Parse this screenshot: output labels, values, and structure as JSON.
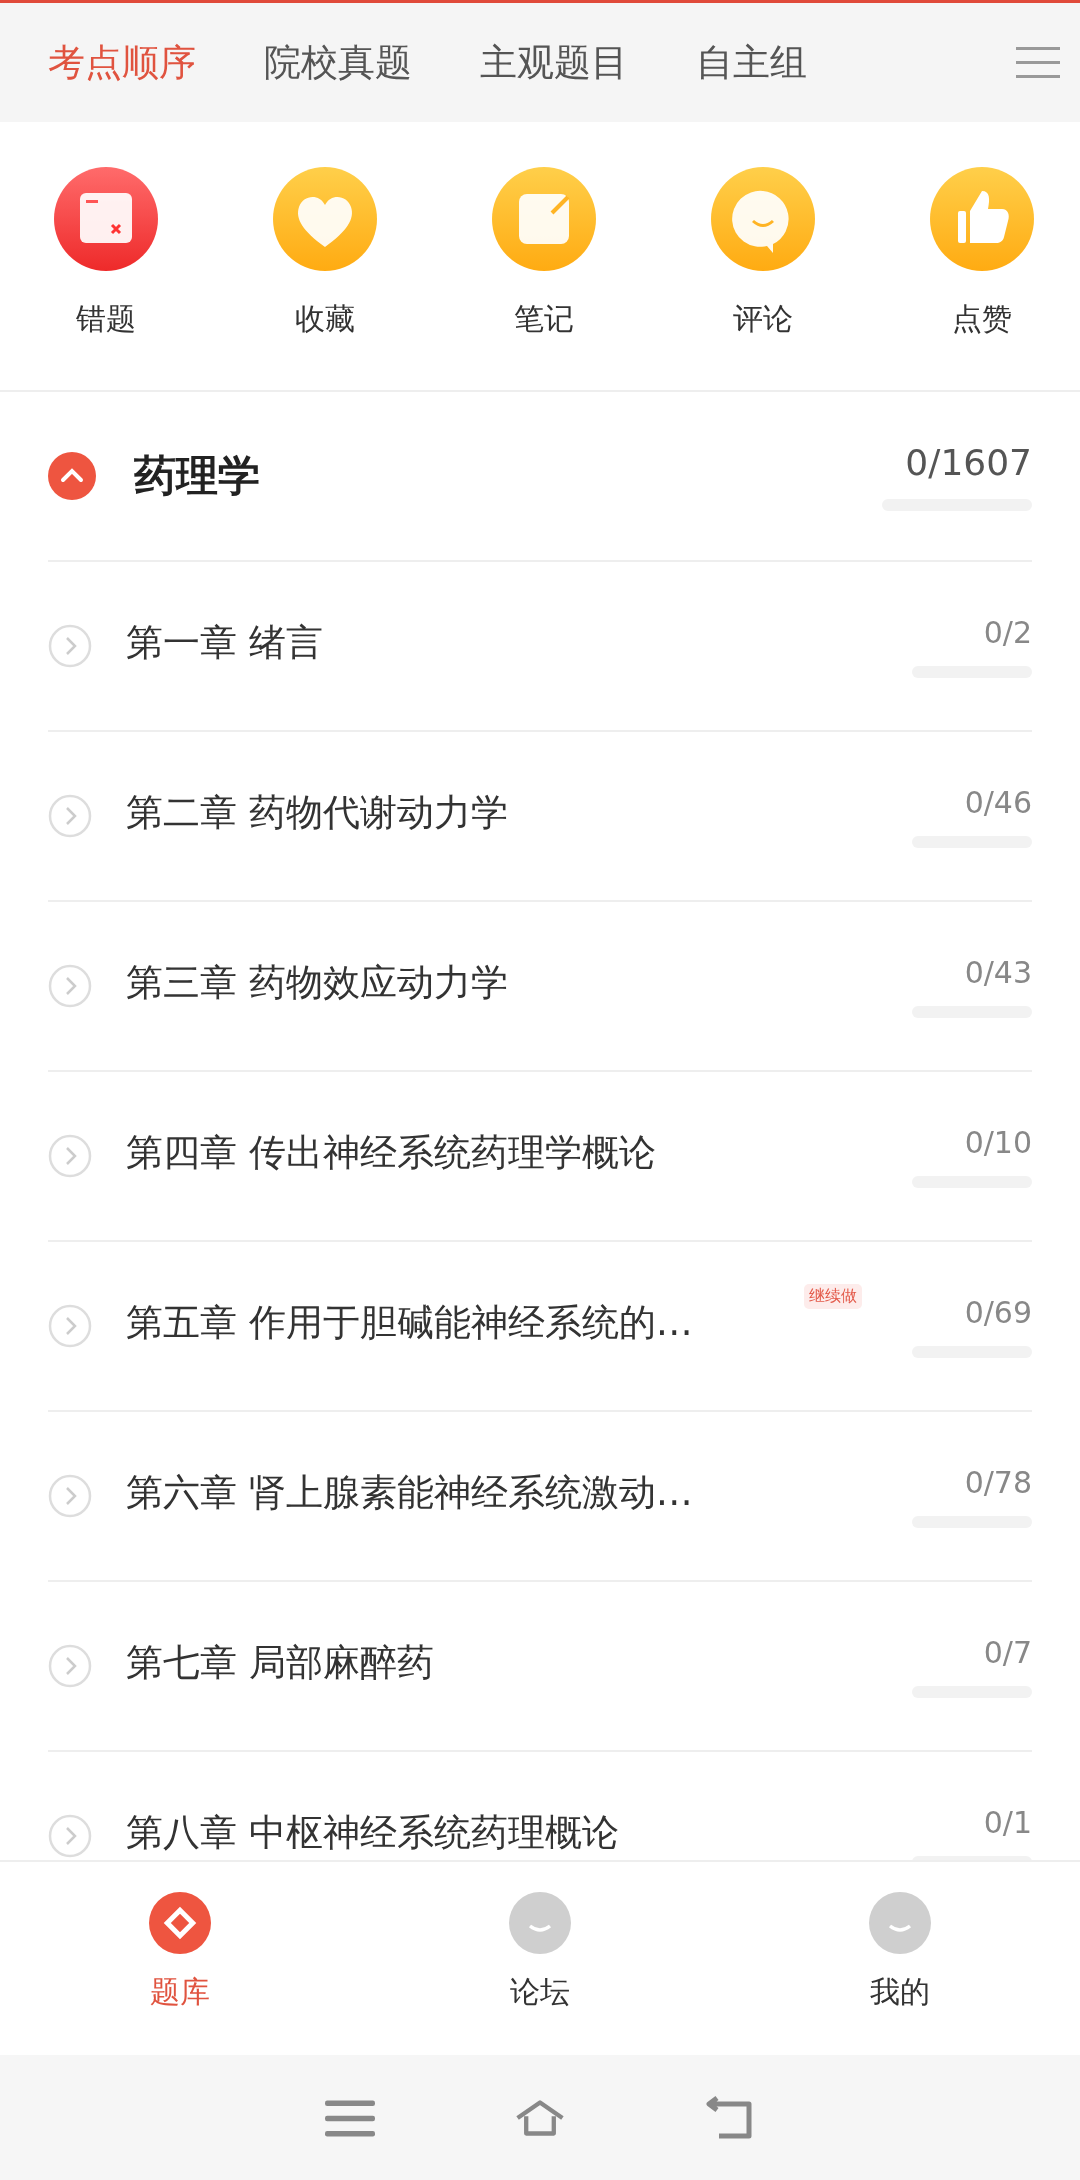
{
  "tabs": [
    {
      "label": "考点顺序",
      "selected": true
    },
    {
      "label": "院校真题",
      "selected": false
    },
    {
      "label": "主观题目",
      "selected": false
    },
    {
      "label": "自主组",
      "selected": false
    }
  ],
  "shortcuts": [
    {
      "label": "错题",
      "kind": "wrong"
    },
    {
      "label": "收藏",
      "kind": "favorite"
    },
    {
      "label": "笔记",
      "kind": "note"
    },
    {
      "label": "评论",
      "kind": "comment"
    },
    {
      "label": "点赞",
      "kind": "like"
    }
  ],
  "subject": {
    "title": "药理学",
    "count": "0/1607",
    "level": 0,
    "expanded": true
  },
  "chapters": [
    {
      "title": "第一章 绪言",
      "count": "0/2",
      "level": 0
    },
    {
      "title": "第二章 药物代谢动力学",
      "count": "0/46",
      "level": 0
    },
    {
      "title": "第三章 药物效应动力学",
      "count": "0/43",
      "level": 0
    },
    {
      "title": "第四章 传出神经系统药理学概论",
      "count": "0/10",
      "level": 0
    },
    {
      "title": "第五章 作用于胆碱能神经系统的…",
      "count": "0/69",
      "level": 0,
      "badge": "继续做"
    },
    {
      "title": "第六章 肾上腺素能神经系统激动…",
      "count": "0/78",
      "level": 0
    },
    {
      "title": "第七章 局部麻醉药",
      "count": "0/7",
      "level": 0
    },
    {
      "title": "第八章 中枢神经系统药理概论",
      "count": "0/1",
      "level": 0
    }
  ],
  "bottom_nav": [
    {
      "label": "题库",
      "kind": "bank",
      "selected": true
    },
    {
      "label": "论坛",
      "kind": "forum",
      "selected": false
    },
    {
      "label": "我的",
      "kind": "profile",
      "selected": false
    }
  ]
}
